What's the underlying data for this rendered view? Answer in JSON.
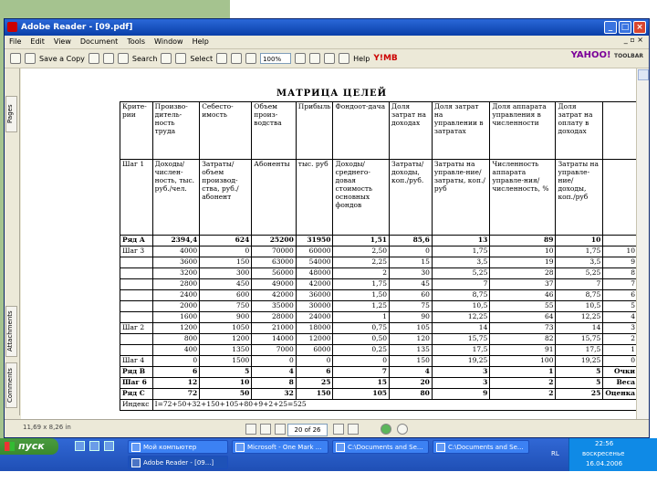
{
  "window": {
    "title": "Adobe Reader - [09.pdf]"
  },
  "menu": [
    "File",
    "Edit",
    "View",
    "Document",
    "Tools",
    "Window",
    "Help"
  ],
  "menu_right": "_ ▫ ×",
  "toolbar": {
    "save_copy": "Save a Copy",
    "search": "Search",
    "select": "Select",
    "zoom": "100%",
    "help": "Help",
    "yahoo": "YAHOO!",
    "yahoo_sub": "TOOLBAR",
    "y_label": "Y!MB"
  },
  "left_tabs": [
    "Pages",
    "Attachments",
    "Comments"
  ],
  "doc": {
    "title": "МАТРИЦА ЦЕЛЕЙ",
    "headers": [
      "Критерии",
      "Производительность",
      "Себестоимость",
      "Объем производства",
      "Прибыль",
      "Фондоотдача",
      "Доля затрат на доходах",
      "Доля затрат на управлении в затратах",
      "Доля аппарата управления в численности",
      "Доля затрат на оплату в доходах"
    ],
    "headers_display": [
      "Крите-рии",
      "Произво-дитель-ность труда",
      "Себесто-имость",
      "Объем произ-водства",
      "Прибыль",
      "Фондоот-дача",
      "Доля затрат на доходах",
      "Доля затрат на управлении в затратах",
      "Доля аппарата управления в численности",
      "Доля затрат на оплату в доходах"
    ],
    "step1": [
      "Шаг 1",
      "Доходы/ числен-ность, тыс. руб./чел.",
      "Затраты/ объем производ-ства, руб./абонент",
      "Абоненты",
      "тыс. руб",
      "Доходы/ среднего-довая стоимость основных фондов",
      "Затраты/ доходы, коп./руб.",
      "Затраты на управле-ние/затраты, коп./руб",
      "Численность аппарата управле-ния/численность, %",
      "Затраты на управле-ние/доходы, коп./руб"
    ],
    "rows": [
      {
        "label": "Ряд А",
        "cells": [
          "2394,4",
          "624",
          "25200",
          "31950",
          "1,51",
          "85,6",
          "13",
          "89",
          "10",
          ""
        ],
        "bold": true
      },
      {
        "label": "Шаг 3",
        "cells": [
          "4000",
          "0",
          "70000",
          "60000",
          "2,50",
          "0",
          "1,75",
          "10",
          "1,75",
          "10"
        ]
      },
      {
        "label": "",
        "cells": [
          "3600",
          "150",
          "63000",
          "54000",
          "2,25",
          "15",
          "3,5",
          "19",
          "3,5",
          "9"
        ]
      },
      {
        "label": "",
        "cells": [
          "3200",
          "300",
          "56000",
          "48000",
          "2",
          "30",
          "5,25",
          "28",
          "5,25",
          "8"
        ]
      },
      {
        "label": "",
        "cells": [
          "2800",
          "450",
          "49000",
          "42000",
          "1,75",
          "45",
          "7",
          "37",
          "7",
          "7"
        ]
      },
      {
        "label": "",
        "cells": [
          "2400",
          "600",
          "42000",
          "36000",
          "1,50",
          "60",
          "8,75",
          "46",
          "8,75",
          "6"
        ]
      },
      {
        "label": "",
        "cells": [
          "2000",
          "750",
          "35000",
          "30000",
          "1,25",
          "75",
          "10,5",
          "55",
          "10,5",
          "5"
        ]
      },
      {
        "label": "",
        "cells": [
          "1600",
          "900",
          "28000",
          "24000",
          "1",
          "90",
          "12,25",
          "64",
          "12,25",
          "4"
        ]
      },
      {
        "label": "Шаг 2",
        "cells": [
          "1200",
          "1050",
          "21000",
          "18000",
          "0,75",
          "105",
          "14",
          "73",
          "14",
          "3"
        ]
      },
      {
        "label": "",
        "cells": [
          "800",
          "1200",
          "14000",
          "12000",
          "0,50",
          "120",
          "15,75",
          "82",
          "15,75",
          "2"
        ]
      },
      {
        "label": "",
        "cells": [
          "400",
          "1350",
          "7000",
          "6000",
          "0,25",
          "135",
          "17,5",
          "91",
          "17,5",
          "1"
        ]
      },
      {
        "label": "Шаг 4",
        "cells": [
          "0",
          "1500",
          "0",
          "0",
          "0",
          "150",
          "19,25",
          "100",
          "19,25",
          "0"
        ]
      },
      {
        "label": "Ряд В",
        "cells": [
          "6",
          "5",
          "4",
          "6",
          "7",
          "4",
          "3",
          "1",
          "5",
          "Очки"
        ],
        "bold": true
      },
      {
        "label": "Шаг 6",
        "cells": [
          "12",
          "10",
          "8",
          "25",
          "15",
          "20",
          "3",
          "2",
          "5",
          "Веса"
        ],
        "bold": true
      },
      {
        "label": "Ряд С",
        "cells": [
          "72",
          "50",
          "32",
          "150",
          "105",
          "80",
          "9",
          "2",
          "25",
          "Оценка"
        ],
        "bold": true
      }
    ],
    "index_label": "Индекс",
    "index_value": "I=72+50+32+150+105+80+9+2+25=525"
  },
  "status": {
    "page_size": "11,69 x 8,26 in",
    "page_indicator": "20 of 26"
  },
  "taskbar": {
    "start": "пуск",
    "tasks": [
      "Мой компьютер",
      "Microsoft - One Mark ...",
      "C:\\Documents and Se...",
      "C:\\Documents and Se...",
      "Adobe Reader - [09...]"
    ],
    "tray_lang": "RL",
    "tray_time": "22:56",
    "tray_day": "воскресенье",
    "tray_date": "16.04.2006"
  },
  "colors": {
    "titlebar": "#0a3fa8",
    "taskbar": "#3168d5",
    "start": "#4a9b3f",
    "accent_green": "#a5c38f",
    "window_bg": "#ece9d8"
  }
}
